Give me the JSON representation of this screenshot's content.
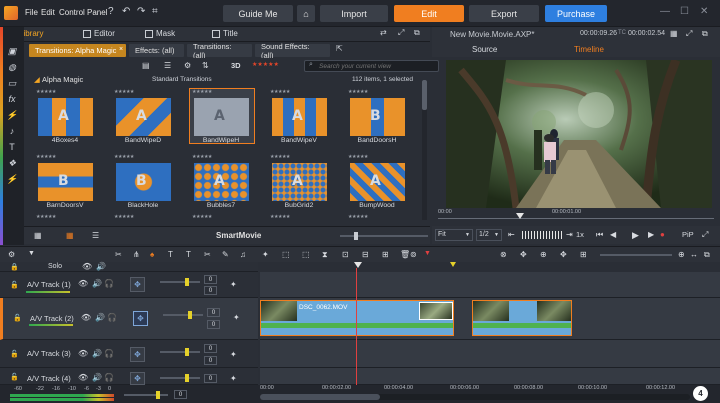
{
  "menubar": {
    "file": "File",
    "edit": "Edit",
    "control_panel": "Control Panel"
  },
  "nav": {
    "guide": "Guide Me",
    "import": "Import",
    "edit": "Edit",
    "export": "Export",
    "purchase": "Purchase"
  },
  "libtabs": [
    {
      "label": "Library"
    },
    {
      "label": "Editor"
    },
    {
      "label": "Mask"
    },
    {
      "label": "Title"
    }
  ],
  "filters": [
    "Transitions: Alpha Magic",
    "Effects: (all)",
    "Transitions: (all)",
    "Sound Effects: (all)"
  ],
  "toolrow": {
    "zoom": "3D",
    "search_placeholder": "Search your current view"
  },
  "grid": {
    "category": "Alpha Magic",
    "section": "Standard Transitions",
    "count": "112 items, 1 selected",
    "row1": [
      "4Boxes4",
      "BandWipeD",
      "BandWipeH",
      "BandWipeV",
      "BandDoorsH"
    ],
    "row2": [
      "BarnDoorsV",
      "BlackHole",
      "Bubbles7",
      "BubGrid2",
      "BumpWood"
    ]
  },
  "smartmovie": "SmartMovie",
  "preview": {
    "title": "New Movie.Movie.AXP*",
    "tc1": "00:00:09.26",
    "tc_label": "TC",
    "tc2": "00:00:02.54",
    "tab_source": "Source",
    "tab_timeline": "Timeline",
    "ruler_start": "00:00",
    "ruler_mid": "00:00:01.00",
    "fit": "Fit",
    "ratio": "1/2",
    "speed": "1x",
    "pip": "PiP"
  },
  "timeline": {
    "solo": "Solo",
    "tracks": [
      {
        "name": "A/V Track (1)",
        "value": "0"
      },
      {
        "name": "A/V Track (2)",
        "value": "0"
      },
      {
        "name": "A/V Track (3)",
        "value": "0"
      },
      {
        "name": "A/V Track (4)",
        "value": "0"
      }
    ],
    "clip_name": "DSC_0062.MOV",
    "ruler": [
      "00:00",
      "00:00:02.00",
      "00:00:04.00",
      "00:00:06.00",
      "00:00:08.00",
      "00:00:10.00",
      "00:00:12.00"
    ],
    "meter": [
      "-60",
      "-22",
      "-16",
      "-10",
      "-6",
      "-3",
      "0"
    ],
    "master": "0",
    "badge": "4"
  },
  "colors": {
    "accent": "#f07e20",
    "purchase": "#2e7fe0",
    "clip": "#6aa9d9"
  }
}
